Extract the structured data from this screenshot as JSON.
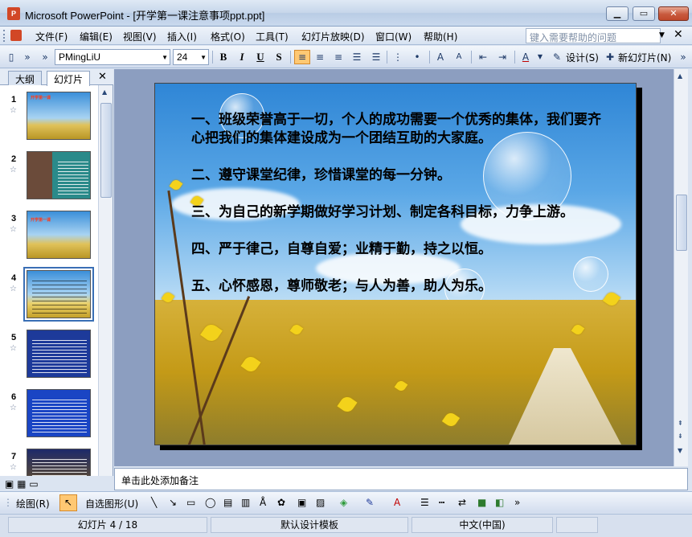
{
  "window": {
    "title": "Microsoft PowerPoint - [开学第一课注意事项ppt.ppt]",
    "app_icon_label": "P",
    "controls": {
      "minimize": "▁",
      "restore": "▭",
      "close": "✕"
    }
  },
  "menu": {
    "items": [
      "文件(F)",
      "编辑(E)",
      "视图(V)",
      "插入(I)",
      "格式(O)",
      "工具(T)",
      "幻灯片放映(D)",
      "窗口(W)",
      "帮助(H)"
    ],
    "help_placeholder": "键入需要帮助的问题"
  },
  "toolbar": {
    "font_name": "PMingLiU",
    "font_size": "24",
    "bold": "B",
    "italic": "I",
    "underline": "U",
    "shadow": "S",
    "design_label": "设计(S)",
    "new_slide_label": "新幻灯片(N)"
  },
  "left_pane": {
    "tabs": [
      "大纲",
      "幻灯片"
    ],
    "active_tab": "幻灯片",
    "thumbnails": [
      {
        "number": "1",
        "title": "开学第一课"
      },
      {
        "number": "2",
        "title": ""
      },
      {
        "number": "3",
        "title": "开学第一课"
      },
      {
        "number": "4",
        "title": "",
        "selected": true
      },
      {
        "number": "5",
        "title": ""
      },
      {
        "number": "6",
        "title": ""
      },
      {
        "number": "7",
        "title": ""
      }
    ]
  },
  "slide": {
    "paragraphs": [
      "一、班级荣誉高于一切，个人的成功需要一个优秀的集体，我们要齐心把我们的集体建设成为一个团结互助的大家庭。",
      "二、遵守课堂纪律，珍惜课堂的每一分钟。",
      "三、为自己的新学期做好学习计划、制定各科目标，力争上游。",
      "四、严于律己，自尊自爱；业精于勤，持之以恒。",
      "五、心怀感恩，尊师敬老；与人为善，助人为乐。"
    ]
  },
  "notes": {
    "placeholder": "单击此处添加备注"
  },
  "draw_toolbar": {
    "draw_label": "绘图(R)",
    "autoshapes_label": "自选图形(U)"
  },
  "status": {
    "slide_position": "幻灯片 4 / 18",
    "template": "默认设计模板",
    "language": "中文(中国)"
  }
}
